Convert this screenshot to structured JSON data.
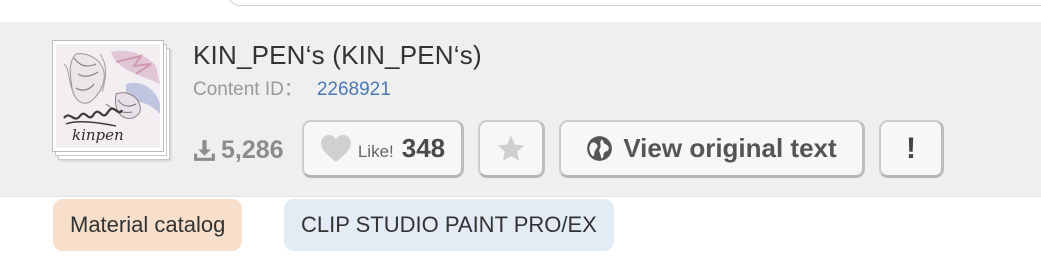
{
  "content": {
    "title": "KIN_PEN‘s (KIN_PEN‘s)",
    "content_id_label": "Content ID：",
    "content_id_value": "2268921",
    "thumbnail_alt": "kinpen"
  },
  "stats": {
    "downloads": "5,286",
    "like_label": "Like!",
    "like_count": "348"
  },
  "actions": {
    "favorite_icon": "star-icon",
    "view_original_label": "View original text",
    "view_original_icon": "globe-icon",
    "report_label": "!"
  },
  "tags": [
    {
      "label": "Material catalog",
      "color": "#f7dfcb"
    },
    {
      "label": "CLIP STUDIO PAINT PRO/EX",
      "color": "#e3ebf5"
    }
  ],
  "colors": {
    "panel_background": "#efefef",
    "link_blue": "#4a7ab8",
    "muted_text": "#9a9a9a"
  }
}
